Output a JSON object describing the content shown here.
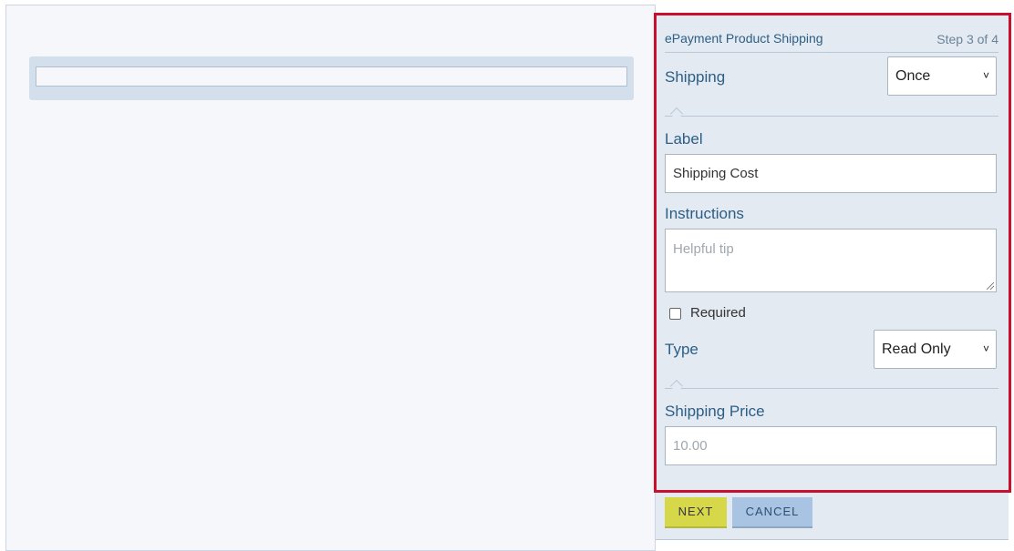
{
  "panel": {
    "title": "ePayment Product Shipping",
    "step": "Step 3 of 4",
    "shipping": {
      "label": "Shipping",
      "value": "Once"
    },
    "label_field": {
      "label": "Label",
      "value": "Shipping Cost"
    },
    "instructions": {
      "label": "Instructions",
      "placeholder": "Helpful tip"
    },
    "required": {
      "label": "Required",
      "checked": false
    },
    "type": {
      "label": "Type",
      "value": "Read Only"
    },
    "shipping_price": {
      "label": "Shipping Price",
      "placeholder": "10.00"
    }
  },
  "footer": {
    "next_label": "NEXT",
    "cancel_label": "CANCEL"
  },
  "colors": {
    "highlight_border": "#c8102e",
    "next_button": "#d6d84a",
    "cancel_button": "#a9c4e3",
    "label_text": "#2c5e86"
  },
  "icons": {
    "select_arrow": "chevron-down-icon",
    "resize_handle": "resize-grip-icon"
  }
}
